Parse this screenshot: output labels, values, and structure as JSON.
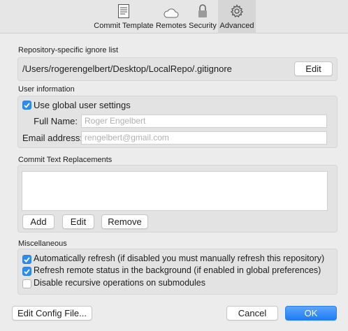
{
  "toolbar": {
    "tabs": [
      {
        "label": "Commit Template",
        "icon": "document-icon"
      },
      {
        "label": "Remotes",
        "icon": "cloud-icon"
      },
      {
        "label": "Security",
        "icon": "lock-icon"
      },
      {
        "label": "Advanced",
        "icon": "gear-icon",
        "active": true
      }
    ]
  },
  "ignore": {
    "title": "Repository-specific ignore list",
    "path": "/Users/rogerengelbert/Desktop/LocalRepo/.gitignore",
    "edit_label": "Edit"
  },
  "user_info": {
    "title": "User information",
    "use_global_label": "Use global user settings",
    "use_global_checked": true,
    "full_name_label": "Full Name:",
    "full_name_placeholder": "Roger Engelbert",
    "email_label": "Email address:",
    "email_placeholder": "rengelbert@gmail.com"
  },
  "replacements": {
    "title": "Commit Text Replacements",
    "add_label": "Add",
    "edit_label": "Edit",
    "remove_label": "Remove"
  },
  "misc": {
    "title": "Miscellaneous",
    "options": [
      {
        "label": "Automatically refresh (if disabled you must manually refresh this repository)",
        "checked": true
      },
      {
        "label": "Refresh remote status in the background (if enabled in global preferences)",
        "checked": true
      },
      {
        "label": "Disable recursive operations on submodules",
        "checked": false
      }
    ]
  },
  "footer": {
    "edit_config_label": "Edit Config File...",
    "cancel_label": "Cancel",
    "ok_label": "OK"
  },
  "colors": {
    "accent": "#2d8cf0"
  }
}
